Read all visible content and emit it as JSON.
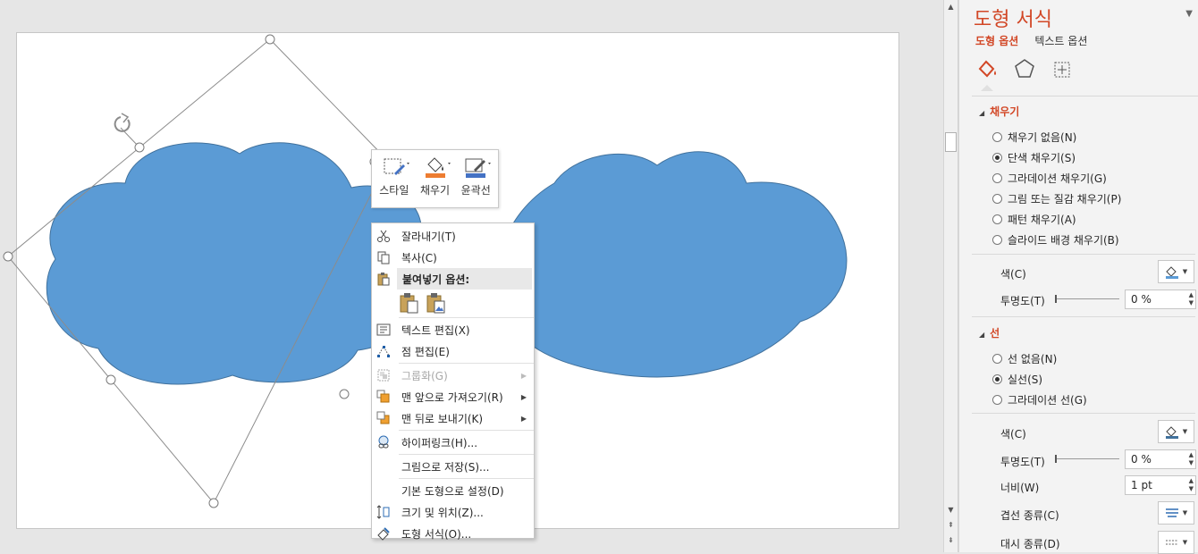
{
  "mini_toolbar": {
    "style_label": "스타일",
    "fill_label": "채우기",
    "outline_label": "윤곽선"
  },
  "context_menu": {
    "cut": "잘라내기(T)",
    "copy": "복사(C)",
    "paste_options": "붙여넣기 옵션:",
    "edit_text": "텍스트 편집(X)",
    "edit_points": "점 편집(E)",
    "group": "그룹화(G)",
    "bring_to_front": "맨 앞으로 가져오기(R)",
    "send_to_back": "맨 뒤로 보내기(K)",
    "hyperlink": "하이퍼링크(H)...",
    "save_as_picture": "그림으로 저장(S)...",
    "set_default_shape": "기본 도형으로 설정(D)",
    "size_position": "크기 및 위치(Z)...",
    "format_shape": "도형 서식(O)..."
  },
  "pane": {
    "title": "도형 서식",
    "tab_shape_options": "도형 옵션",
    "tab_text_options": "텍스트 옵션",
    "fill_section": "채우기",
    "fill_options": [
      {
        "label": "채우기 없음(N)",
        "checked": false
      },
      {
        "label": "단색 채우기(S)",
        "checked": true
      },
      {
        "label": "그라데이션 채우기(G)",
        "checked": false
      },
      {
        "label": "그림 또는 질감 채우기(P)",
        "checked": false
      },
      {
        "label": "패턴 채우기(A)",
        "checked": false
      },
      {
        "label": "슬라이드 배경 채우기(B)",
        "checked": false
      }
    ],
    "fill_color_label": "색(C)",
    "fill_transparency_label": "투명도(T)",
    "fill_transparency_value": "0 %",
    "line_section": "선",
    "line_options": [
      {
        "label": "선 없음(N)",
        "checked": false
      },
      {
        "label": "실선(S)",
        "checked": true
      },
      {
        "label": "그라데이션 선(G)",
        "checked": false
      }
    ],
    "line_color_label": "색(C)",
    "line_transparency_label": "투명도(T)",
    "line_transparency_value": "0 %",
    "width_label": "너비(W)",
    "width_value": "1 pt",
    "compound_label": "겹선 종류(C)",
    "dash_label": "대시 종류(D)"
  },
  "colors": {
    "cloud_fill": "#5b9bd5",
    "cloud_stroke": "#41719c",
    "accent": "#d24726",
    "fill_bucket_bar": "#ed7d31",
    "outline_bar": "#4472c4"
  }
}
